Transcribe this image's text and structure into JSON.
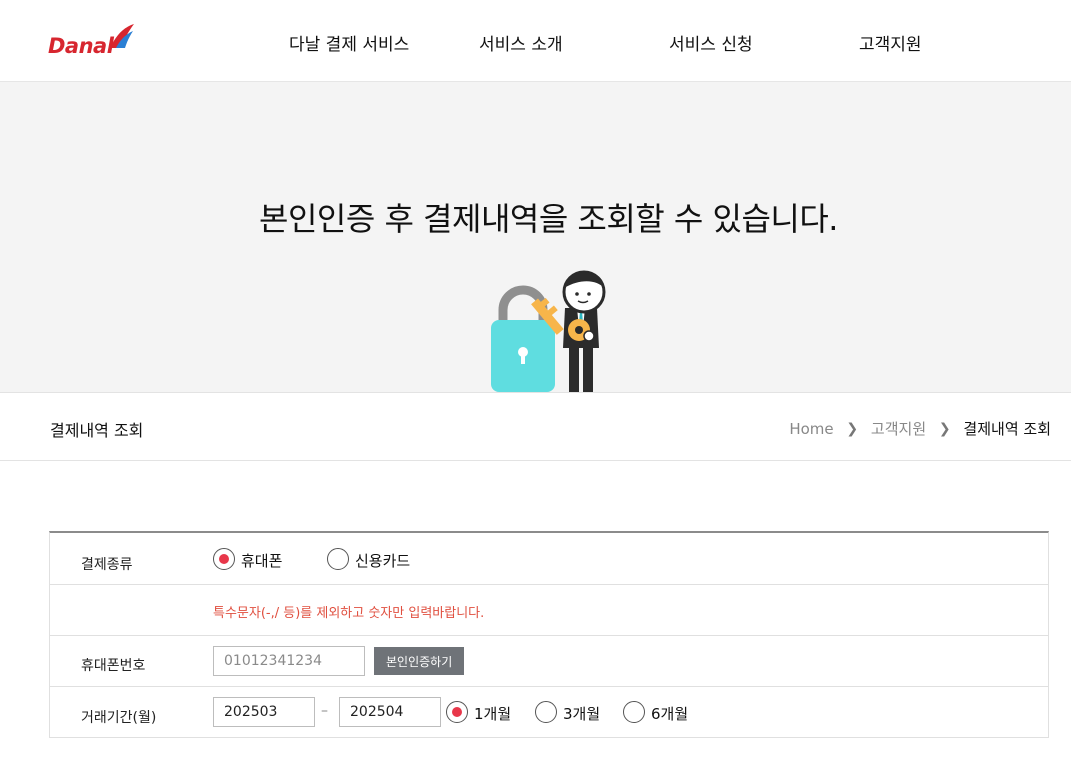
{
  "brand": {
    "logo_text": "Danal"
  },
  "nav": {
    "items": [
      "다날 결제 서비스",
      "서비스 소개",
      "서비스 신청",
      "고객지원"
    ]
  },
  "hero": {
    "title": "본인인증 후 결제내역을 조회할 수 있습니다."
  },
  "subbar": {
    "page_title": "결제내역 조회",
    "breadcrumb": [
      "Home",
      "고객지원",
      "결제내역 조회"
    ]
  },
  "form": {
    "payment_type": {
      "label": "결제종류",
      "options": [
        {
          "label": "휴대폰",
          "checked": true
        },
        {
          "label": "신용카드",
          "checked": false
        }
      ]
    },
    "notice": "특수문자(-,/ 등)를 제외하고 숫자만 입력바랍니다.",
    "phone": {
      "label": "휴대폰번호",
      "placeholder": "01012341234",
      "button": "본인인증하기"
    },
    "period": {
      "label": "거래기간(월)",
      "from": "202503",
      "to": "202504",
      "separator": "–",
      "options": [
        {
          "label": "1개월",
          "checked": true
        },
        {
          "label": "3개월",
          "checked": false
        },
        {
          "label": "6개월",
          "checked": false
        }
      ]
    }
  },
  "colors": {
    "brand_red": "#d7262f",
    "accent_red": "#e8374a",
    "notice_red": "#e04f3f",
    "button_gray": "#6f7378"
  }
}
